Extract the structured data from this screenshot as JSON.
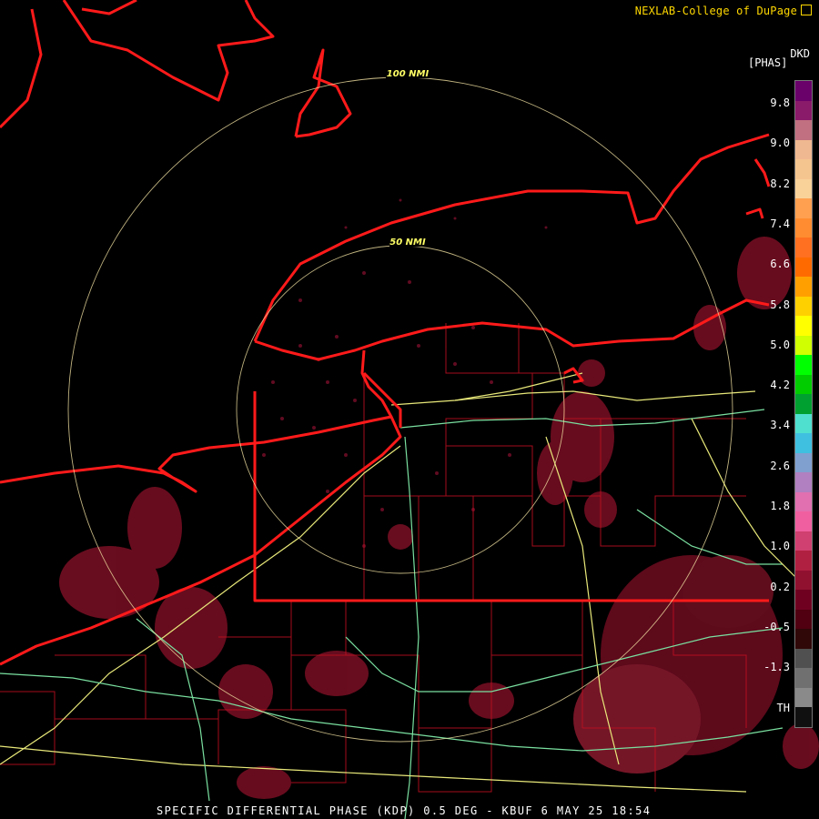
{
  "credit": "NEXLAB-College of DuPage",
  "legend": {
    "units": "[PHAS]",
    "product_code": "DKD",
    "ticks": [
      "9.8",
      "9.0",
      "8.2",
      "7.4",
      "6.6",
      "5.8",
      "5.0",
      "4.2",
      "3.4",
      "2.6",
      "1.8",
      "1.0",
      "0.2",
      "-0.5",
      "-1.3",
      "TH"
    ],
    "colors": [
      "#6a006a",
      "#8a1a6a",
      "#c07080",
      "#f0b890",
      "#f5c590",
      "#f9d29a",
      "#ffa050",
      "#ff8c30",
      "#ff7020",
      "#ff6a00",
      "#ffa000",
      "#ffd000",
      "#ffff00",
      "#cfff00",
      "#00ff00",
      "#00cc00",
      "#00a030",
      "#50e0d0",
      "#40c0e0",
      "#80a0d0",
      "#b080c0",
      "#e070b0",
      "#f060a0",
      "#d04070",
      "#b02040",
      "#901030",
      "#700020",
      "#500010",
      "#300808",
      "#505050",
      "#707070",
      "#8a8a8a",
      "#101010"
    ]
  },
  "rings": [
    {
      "label": "100 NMI"
    },
    {
      "label": "50 NMI"
    }
  ],
  "caption": "SPECIFIC DIFFERENTIAL PHASE (KDP) 0.5 DEG - KBUF 6 MAY 25 18:54"
}
